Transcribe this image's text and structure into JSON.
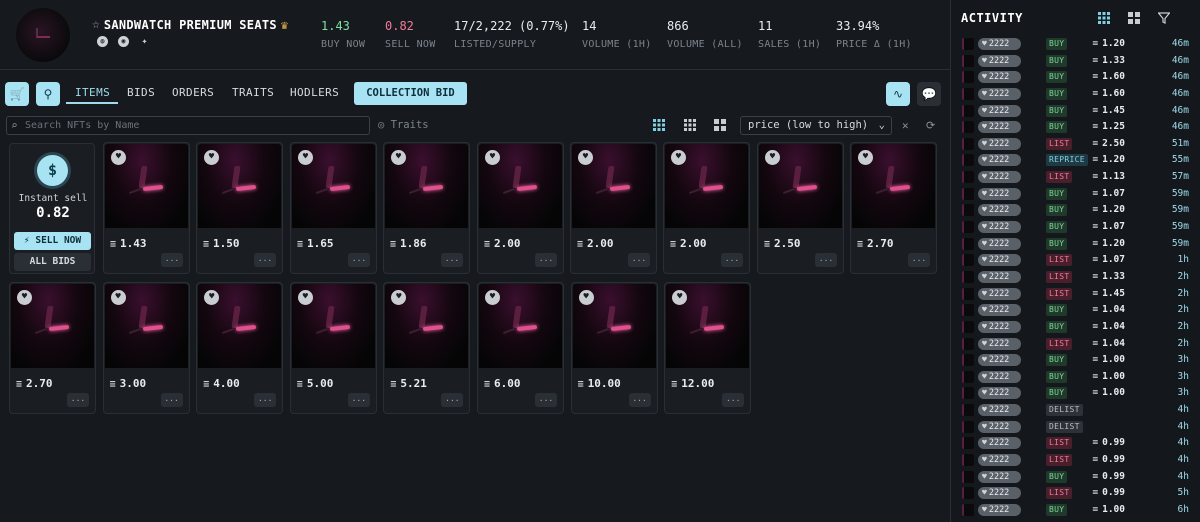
{
  "collection": {
    "name": "SANDWATCH PREMIUM SEATS",
    "stats": [
      {
        "value": "1.43",
        "label": "BUY NOW",
        "color": "#7ee0a2"
      },
      {
        "value": "0.82",
        "label": "SELL NOW",
        "color": "#f07a9a"
      },
      {
        "value": "17/2,222 (0.77%)",
        "label": "LISTED/SUPPLY",
        "color": "#e9ecef"
      },
      {
        "value": "14",
        "label": "VOLUME (1H)",
        "color": "#e9ecef"
      },
      {
        "value": "866",
        "label": "VOLUME (ALL)",
        "color": "#e9ecef"
      },
      {
        "value": "11",
        "label": "SALES (1H)",
        "color": "#e9ecef"
      },
      {
        "value": "33.94%",
        "label": "PRICE Δ (1H)",
        "color": "#e9ecef"
      }
    ]
  },
  "tabs": [
    "ITEMS",
    "BIDS",
    "ORDERS",
    "TRAITS",
    "HODLERS"
  ],
  "collection_bid_label": "COLLECTION BID",
  "search": {
    "placeholder": "Search NFTs by Name"
  },
  "traits_label": "Traits",
  "sort": {
    "selected": "price (low to high)"
  },
  "instant_sell": {
    "label": "Instant sell",
    "value": "0.82",
    "sell_now": "SELL NOW",
    "all_bids": "ALL BIDS"
  },
  "items": [
    {
      "price": "1.43"
    },
    {
      "price": "1.50"
    },
    {
      "price": "1.65"
    },
    {
      "price": "1.86"
    },
    {
      "price": "2.00"
    },
    {
      "price": "2.00"
    },
    {
      "price": "2.00"
    },
    {
      "price": "2.50"
    },
    {
      "price": "2.70"
    },
    {
      "price": "2.70"
    },
    {
      "price": "3.00"
    },
    {
      "price": "4.00"
    },
    {
      "price": "5.00"
    },
    {
      "price": "5.21"
    },
    {
      "price": "6.00"
    },
    {
      "price": "10.00"
    },
    {
      "price": "12.00"
    }
  ],
  "more_label": "...",
  "activity": {
    "title": "ACTIVITY",
    "rows": [
      {
        "id": "2222",
        "type": "BUY",
        "amount": "1.20",
        "time": "46m"
      },
      {
        "id": "2222",
        "type": "BUY",
        "amount": "1.33",
        "time": "46m"
      },
      {
        "id": "2222",
        "type": "BUY",
        "amount": "1.60",
        "time": "46m"
      },
      {
        "id": "2222",
        "type": "BUY",
        "amount": "1.60",
        "time": "46m"
      },
      {
        "id": "2222",
        "type": "BUY",
        "amount": "1.45",
        "time": "46m"
      },
      {
        "id": "2222",
        "type": "BUY",
        "amount": "1.25",
        "time": "46m"
      },
      {
        "id": "2222",
        "type": "LIST",
        "amount": "2.50",
        "time": "51m"
      },
      {
        "id": "2222",
        "type": "REPRICE",
        "amount": "1.20",
        "time": "55m"
      },
      {
        "id": "2222",
        "type": "LIST",
        "amount": "1.13",
        "time": "57m"
      },
      {
        "id": "2222",
        "type": "BUY",
        "amount": "1.07",
        "time": "59m"
      },
      {
        "id": "2222",
        "type": "BUY",
        "amount": "1.20",
        "time": "59m"
      },
      {
        "id": "2222",
        "type": "BUY",
        "amount": "1.07",
        "time": "59m"
      },
      {
        "id": "2222",
        "type": "BUY",
        "amount": "1.20",
        "time": "59m"
      },
      {
        "id": "2222",
        "type": "LIST",
        "amount": "1.07",
        "time": "1h"
      },
      {
        "id": "2222",
        "type": "LIST",
        "amount": "1.33",
        "time": "2h"
      },
      {
        "id": "2222",
        "type": "LIST",
        "amount": "1.45",
        "time": "2h"
      },
      {
        "id": "2222",
        "type": "BUY",
        "amount": "1.04",
        "time": "2h"
      },
      {
        "id": "2222",
        "type": "BUY",
        "amount": "1.04",
        "time": "2h"
      },
      {
        "id": "2222",
        "type": "LIST",
        "amount": "1.04",
        "time": "2h"
      },
      {
        "id": "2222",
        "type": "BUY",
        "amount": "1.00",
        "time": "3h"
      },
      {
        "id": "2222",
        "type": "BUY",
        "amount": "1.00",
        "time": "3h"
      },
      {
        "id": "2222",
        "type": "BUY",
        "amount": "1.00",
        "time": "3h"
      },
      {
        "id": "2222",
        "type": "DELIST",
        "amount": "",
        "time": "4h"
      },
      {
        "id": "2222",
        "type": "DELIST",
        "amount": "",
        "time": "4h"
      },
      {
        "id": "2222",
        "type": "LIST",
        "amount": "0.99",
        "time": "4h"
      },
      {
        "id": "2222",
        "type": "LIST",
        "amount": "0.99",
        "time": "4h"
      },
      {
        "id": "2222",
        "type": "BUY",
        "amount": "0.99",
        "time": "4h"
      },
      {
        "id": "2222",
        "type": "LIST",
        "amount": "0.99",
        "time": "5h"
      },
      {
        "id": "2222",
        "type": "BUY",
        "amount": "1.00",
        "time": "6h"
      }
    ]
  }
}
